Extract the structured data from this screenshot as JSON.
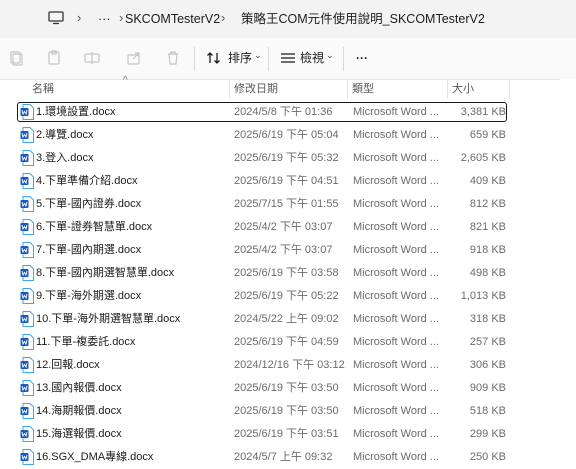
{
  "address_bar": {
    "more": "···",
    "crumb_1": "SKCOMTesterV2",
    "crumb_2": "策略王COM元件使用說明_SKCOMTesterV2"
  },
  "toolbar": {
    "sort_label": "排序",
    "view_label": "檢視",
    "more_label": "···"
  },
  "columns": {
    "name": "名稱",
    "date": "修改日期",
    "type": "類型",
    "size": "大小"
  },
  "files": [
    {
      "name": "1.環境設置.docx",
      "date": "2024/5/8 下午 01:36",
      "type": "Microsoft Word ...",
      "size": "3,381 KB",
      "selected": true
    },
    {
      "name": "2.導覽.docx",
      "date": "2025/6/19 下午 05:04",
      "type": "Microsoft Word ...",
      "size": "659 KB"
    },
    {
      "name": "3.登入.docx",
      "date": "2025/6/19 下午 05:32",
      "type": "Microsoft Word ...",
      "size": "2,605 KB"
    },
    {
      "name": "4.下單準備介紹.docx",
      "date": "2025/6/19 下午 04:51",
      "type": "Microsoft Word ...",
      "size": "409 KB"
    },
    {
      "name": "5.下單-國內證券.docx",
      "date": "2025/7/15 下午 01:55",
      "type": "Microsoft Word ...",
      "size": "812 KB"
    },
    {
      "name": "6.下單-證券智慧單.docx",
      "date": "2025/4/2 下午 03:07",
      "type": "Microsoft Word ...",
      "size": "821 KB"
    },
    {
      "name": "7.下單-國內期選.docx",
      "date": "2025/4/2 下午 03:07",
      "type": "Microsoft Word ...",
      "size": "918 KB"
    },
    {
      "name": "8.下單-國內期選智慧單.docx",
      "date": "2025/6/19 下午 03:58",
      "type": "Microsoft Word ...",
      "size": "498 KB"
    },
    {
      "name": "9.下單-海外期選.docx",
      "date": "2025/6/19 下午 05:22",
      "type": "Microsoft Word ...",
      "size": "1,013 KB"
    },
    {
      "name": "10.下單-海外期選智慧單.docx",
      "date": "2024/5/22 上午 09:02",
      "type": "Microsoft Word ...",
      "size": "318 KB"
    },
    {
      "name": "11.下單-複委託.docx",
      "date": "2025/6/19 下午 04:59",
      "type": "Microsoft Word ...",
      "size": "257 KB"
    },
    {
      "name": "12.回報.docx",
      "date": "2024/12/16 下午 03:12",
      "type": "Microsoft Word ...",
      "size": "306 KB"
    },
    {
      "name": "13.國內報價.docx",
      "date": "2025/6/19 下午 03:50",
      "type": "Microsoft Word ...",
      "size": "909 KB"
    },
    {
      "name": "14.海期報價.docx",
      "date": "2025/6/19 下午 03:50",
      "type": "Microsoft Word ...",
      "size": "518 KB"
    },
    {
      "name": "15.海選報價.docx",
      "date": "2025/6/19 下午 03:51",
      "type": "Microsoft Word ...",
      "size": "299 KB"
    },
    {
      "name": "16.SGX_DMA專線.docx",
      "date": "2024/5/7 上午 09:32",
      "type": "Microsoft Word ...",
      "size": "250 KB"
    }
  ]
}
